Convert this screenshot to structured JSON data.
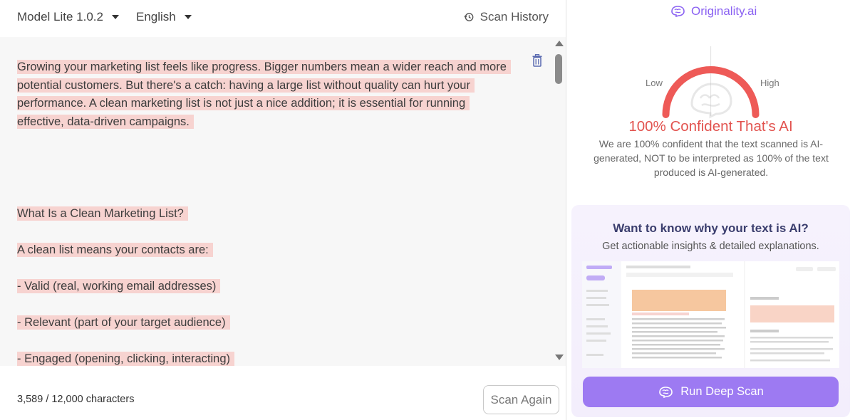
{
  "header": {
    "model_label": "Model Lite 1.0.2",
    "language_label": "English",
    "history_label": "Scan History"
  },
  "content": {
    "intro": "Growing your marketing list feels like progress. Bigger numbers mean a wider reach and more potential customers. But there's a catch: having a large list without quality can hurt your performance. A clean marketing list is not just a nice addition; it is essential for running effective, data-driven campaigns.",
    "heading": "What Is a Clean Marketing List?",
    "lead": "A clean list means your contacts are:",
    "bullets": [
      "- Valid (real, working email addresses)",
      "- Relevant (part of your target audience)",
      "- Engaged (opening, clicking, interacting)"
    ]
  },
  "footer": {
    "char_count": "3,589 / 12,000 characters",
    "scan_again_label": "Scan Again"
  },
  "result": {
    "brand": "Originality.ai",
    "low_label": "Low",
    "high_label": "High",
    "confidence_percent": 100,
    "verdict": "100% Confident That's AI",
    "explanation": "We are 100% confident that the text scanned is AI-generated, NOT to be interpreted as 100% of the text produced is AI-generated."
  },
  "promo": {
    "title": "Want to know why your text is AI?",
    "subtitle": "Get actionable insights & detailed explanations.",
    "button_label": "Run Deep Scan"
  },
  "colors": {
    "accent": "#9d7af2",
    "brand": "#8a61f2",
    "alert": "#e2534f",
    "highlight": "#f7d3d0"
  }
}
